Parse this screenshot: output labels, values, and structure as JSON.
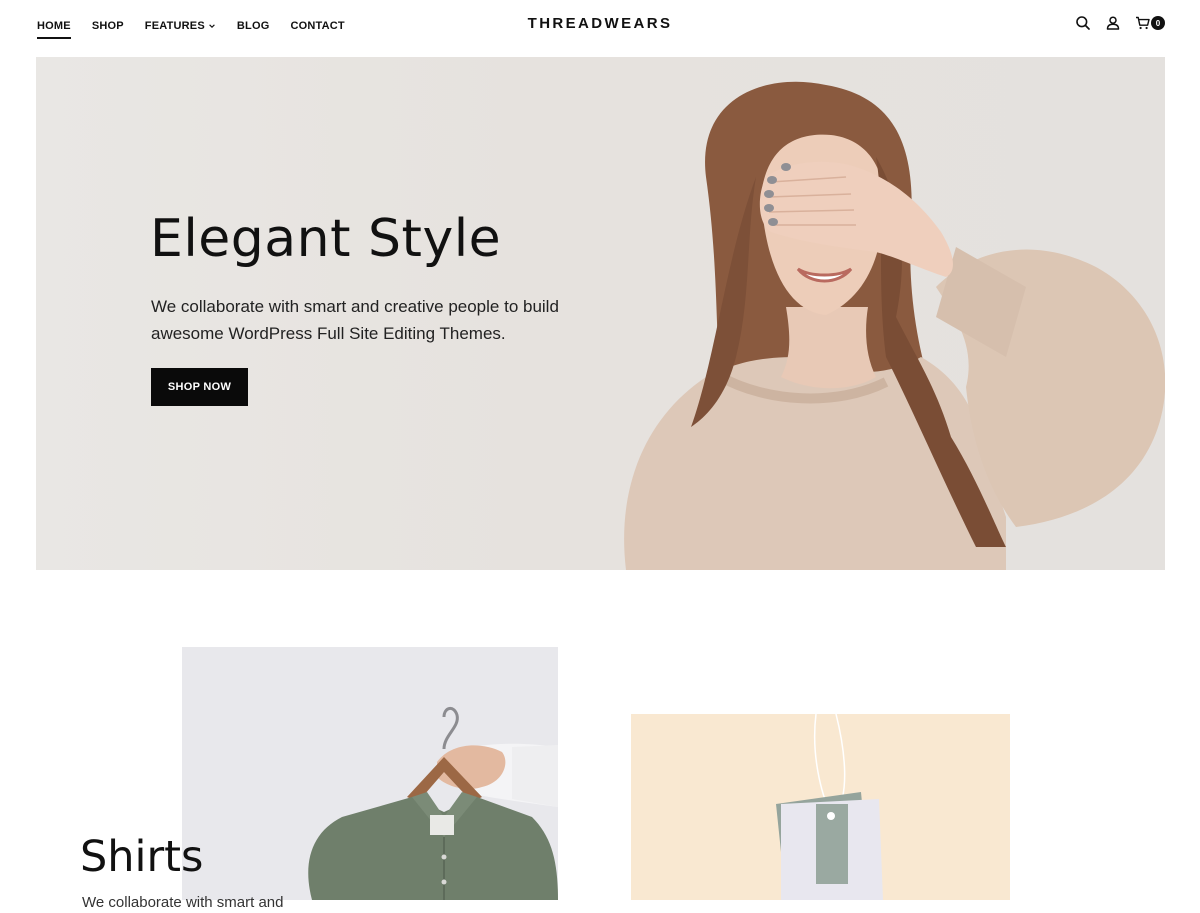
{
  "header": {
    "logo": "THREADWEARS",
    "nav": [
      {
        "label": "HOME",
        "active": true
      },
      {
        "label": "SHOP",
        "active": false
      },
      {
        "label": "FEATURES",
        "active": false,
        "has_dropdown": true
      },
      {
        "label": "BLOG",
        "active": false
      },
      {
        "label": "CONTACT",
        "active": false
      }
    ],
    "icons": [
      "search-icon",
      "user-icon",
      "cart-icon"
    ],
    "cart_count": "0"
  },
  "hero": {
    "title": "Elegant Style",
    "text": "We collaborate with smart and creative people to build awesome WordPress Full Site Editing Themes.",
    "button": "SHOP NOW",
    "background_color": "#e7e4e1"
  },
  "categories": {
    "shirts": {
      "title": "Shirts",
      "text": "We collaborate with smart and"
    },
    "colors": {
      "shirts_bg": "#e8e8ec",
      "tags_bg": "#f9e8d1"
    }
  }
}
